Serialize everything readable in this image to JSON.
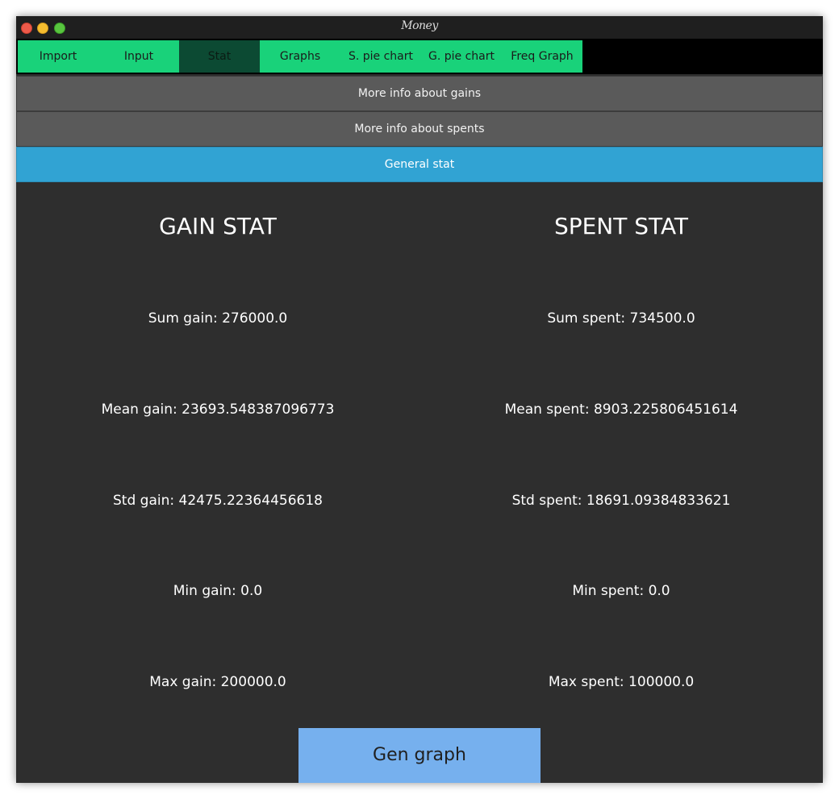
{
  "window": {
    "title": "Money"
  },
  "tabs": [
    {
      "label": "Import"
    },
    {
      "label": "Input"
    },
    {
      "label": "Stat"
    },
    {
      "label": "Graphs"
    },
    {
      "label": "S. pie chart"
    },
    {
      "label": "G. pie chart"
    },
    {
      "label": "Freq Graph"
    }
  ],
  "active_tab": "Stat",
  "sub_buttons": {
    "gains_label": "More info about gains",
    "spents_label": "More info about spents",
    "general_label": "General stat",
    "active": "General stat"
  },
  "gain_stat": {
    "heading": "GAIN STAT",
    "sum": "Sum gain: 276000.0",
    "mean": "Mean gain: 23693.548387096773",
    "std": "Std gain: 42475.22364456618",
    "min": "Min gain: 0.0",
    "max": "Max gain: 200000.0"
  },
  "spent_stat": {
    "heading": "SPENT STAT",
    "sum": "Sum spent: 734500.0",
    "mean": "Mean spent: 8903.225806451614",
    "std": "Std spent: 18691.09384833621",
    "min": "Min spent: 0.0",
    "max": "Max spent: 100000.0"
  },
  "actions": {
    "gen_graph_label": "Gen graph"
  },
  "colors": {
    "tab_bg": "#19d27a",
    "tab_active_bg": "#0c4a33",
    "sub_button_bg": "#5a5a5a",
    "sub_button_active_bg": "#31a3d3",
    "content_bg": "#2e2e2e",
    "gen_button_bg": "#76b0ee"
  }
}
